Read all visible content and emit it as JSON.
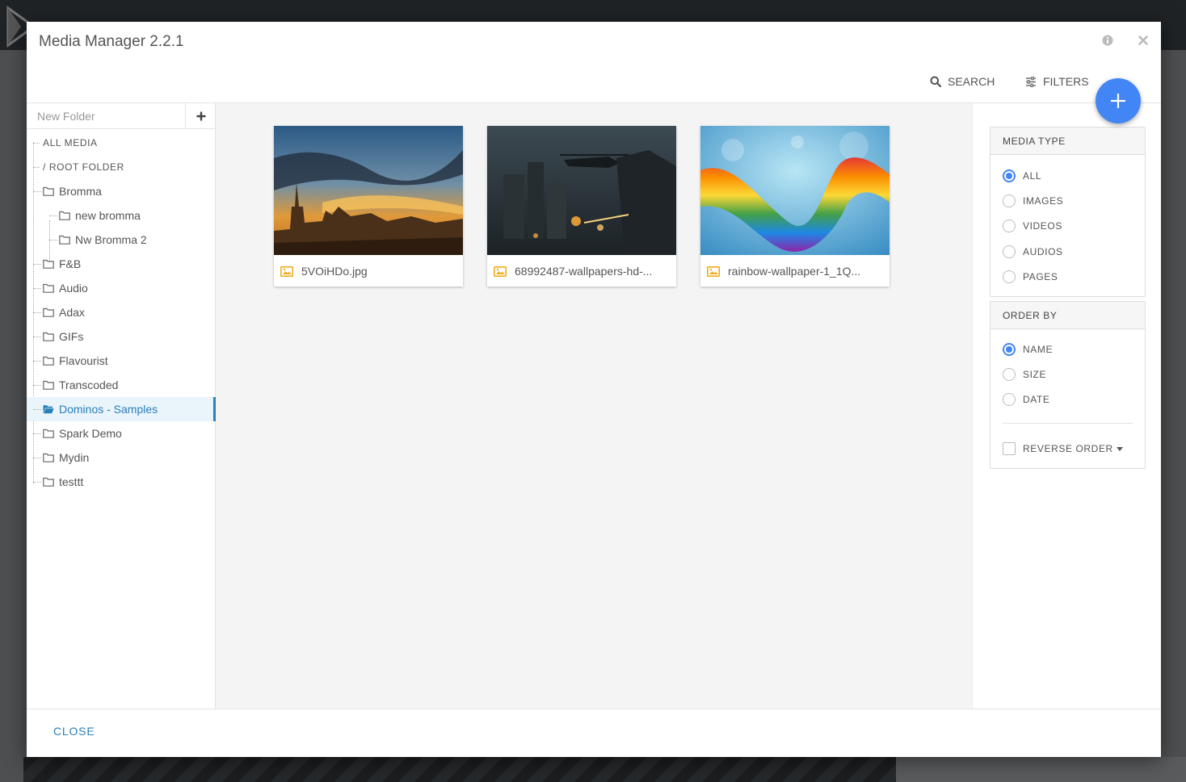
{
  "modal": {
    "title": "Media Manager 2.2.1",
    "info_icon": "info-circle-icon",
    "close_icon": "close-icon"
  },
  "toolbar": {
    "search_label": "SEARCH",
    "filters_label": "FILTERS",
    "add_icon": "plus-icon"
  },
  "sidebar": {
    "new_folder_placeholder": "New Folder",
    "items": [
      {
        "label": "ALL MEDIA"
      },
      {
        "label": "/ ROOT FOLDER"
      },
      {
        "label": "Bromma"
      },
      {
        "label": "new bromma"
      },
      {
        "label": "Nw Bromma 2"
      },
      {
        "label": "F&B"
      },
      {
        "label": "Audio"
      },
      {
        "label": "Adax"
      },
      {
        "label": "GIFs"
      },
      {
        "label": "Flavourist"
      },
      {
        "label": "Transcoded"
      },
      {
        "label": "Dominos - Samples",
        "selected": true
      },
      {
        "label": "Spark Demo"
      },
      {
        "label": "Mydin"
      },
      {
        "label": "testtt"
      }
    ]
  },
  "media": [
    {
      "filename": "5VOiHDo.jpg"
    },
    {
      "filename": "68992487-wallpapers-hd-..."
    },
    {
      "filename": "rainbow-wallpaper-1_1Q..."
    }
  ],
  "filters": {
    "media_type": {
      "title": "MEDIA TYPE",
      "options": [
        "ALL",
        "IMAGES",
        "VIDEOS",
        "AUDIOS",
        "PAGES"
      ],
      "selected": "ALL"
    },
    "order_by": {
      "title": "ORDER BY",
      "options": [
        "NAME",
        "SIZE",
        "DATE"
      ],
      "selected": "NAME",
      "reverse_label": "REVERSE ORDER"
    }
  },
  "footer": {
    "close_label": "CLOSE"
  },
  "colors": {
    "accent": "#4285f4",
    "link": "#2a7fb8",
    "image_icon": "#f0ad1c"
  }
}
